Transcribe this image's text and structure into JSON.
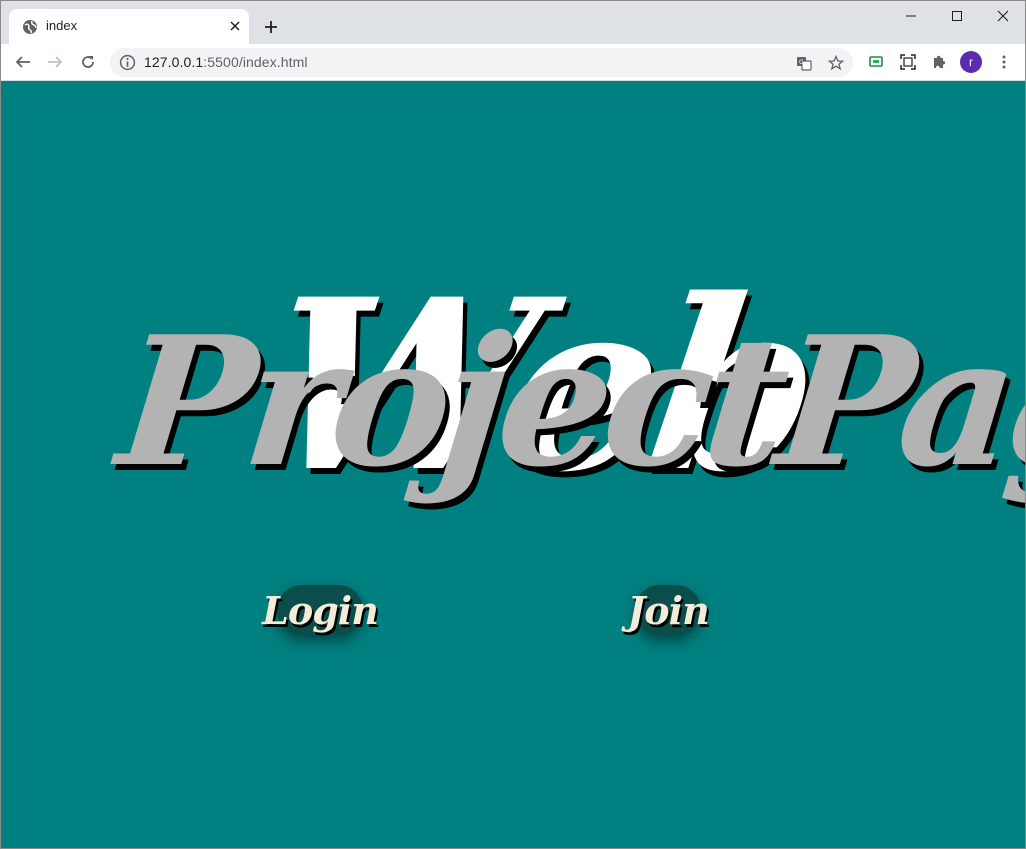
{
  "browser": {
    "tab_title": "index",
    "url_host": "127.0.0.1",
    "url_path": ":5500/index.html",
    "avatar_letter": "r",
    "icons": {
      "favicon": "globe-icon",
      "back": "back-arrow-icon",
      "forward": "forward-arrow-icon",
      "reload": "reload-icon",
      "info": "info-icon",
      "translate": "translate-icon",
      "bookmark": "star-icon",
      "cast": "cast-icon",
      "screenshot": "screen-capture-icon",
      "extensions": "puzzle-icon",
      "menu": "kebab-menu-icon"
    }
  },
  "page": {
    "background_color": "#008080",
    "hero_back_text": "Web",
    "hero_front_text": "ProjectPage",
    "buttons": {
      "login_label": "Login",
      "join_label": "Join"
    }
  }
}
